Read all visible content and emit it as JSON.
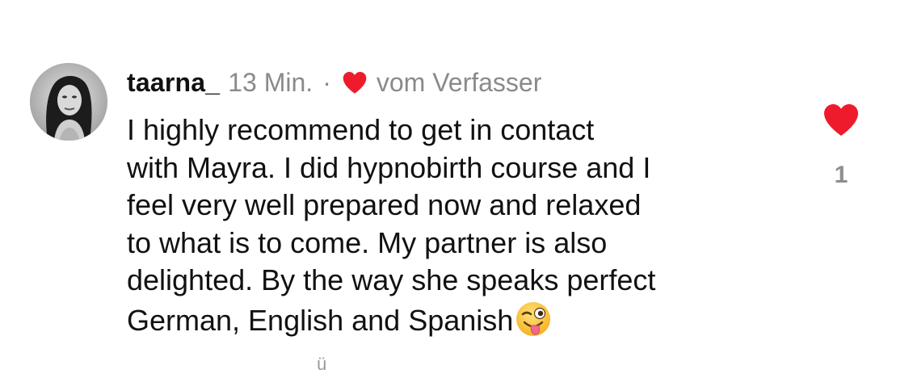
{
  "comment": {
    "username": "taarna_",
    "time": "13 Min.",
    "separator": "·",
    "author_like_label": "vom Verfasser",
    "lines": [
      "I highly recommend to get in contact",
      "with Mayra. I did hypnobirth course and I",
      "feel very well prepared now and relaxed",
      "to what is to come. My partner is also",
      "delighted. By the way she speaks perfect",
      "German, English and Spanish"
    ],
    "trailing_emoji": "winking-face-with-tongue-emoji",
    "avatar_icon": "profile-photo",
    "like_icon": "heart-icon",
    "like_count": "1",
    "peek_glyph": "ü"
  },
  "colors": {
    "heart": "#ee1b2c",
    "text": "#111111",
    "muted": "#8a8a8a",
    "count": "#8e8e8e"
  }
}
